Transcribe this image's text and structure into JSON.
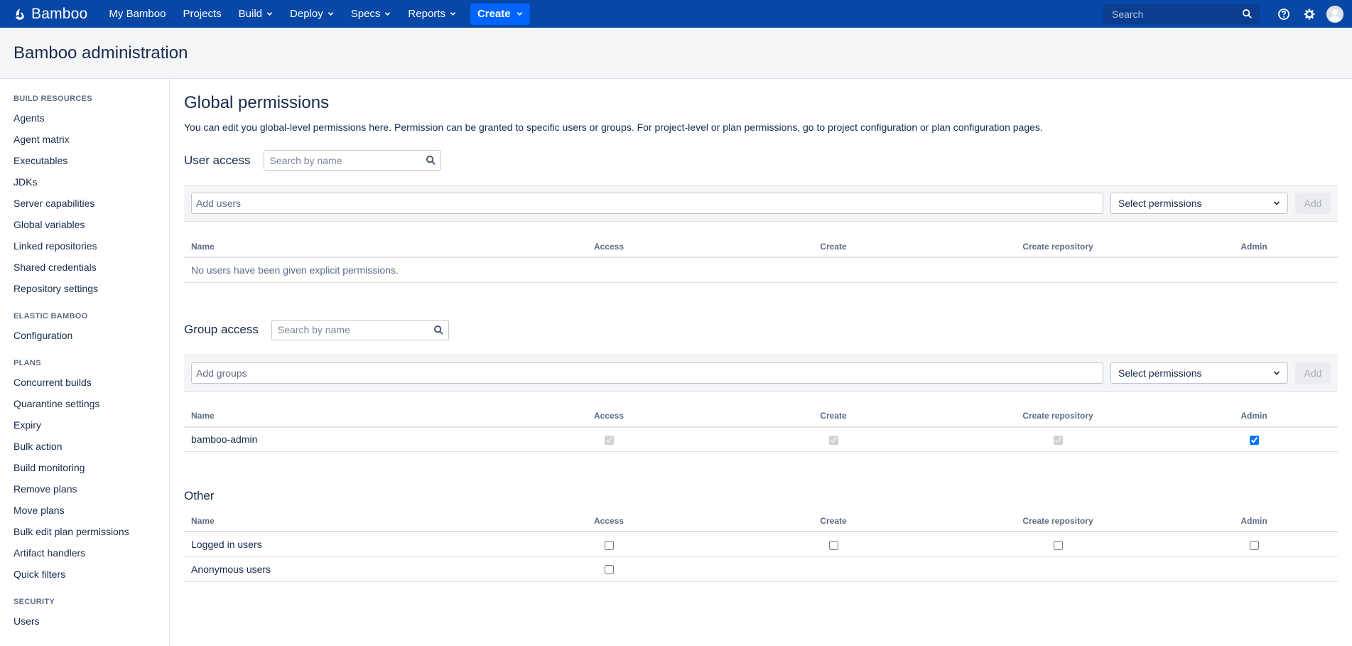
{
  "nav": {
    "logo_text": "Bamboo",
    "links": [
      {
        "label": "My Bamboo",
        "dropdown": false
      },
      {
        "label": "Projects",
        "dropdown": false
      },
      {
        "label": "Build",
        "dropdown": true
      },
      {
        "label": "Deploy",
        "dropdown": true
      },
      {
        "label": "Specs",
        "dropdown": true
      },
      {
        "label": "Reports",
        "dropdown": true
      }
    ],
    "create_label": "Create",
    "search_placeholder": "Search",
    "icons": [
      "help-icon",
      "gear-icon",
      "avatar"
    ],
    "colors": {
      "bar": "#0747a6",
      "create": "#0065ff"
    }
  },
  "header": {
    "title": "Bamboo administration"
  },
  "sidebar": {
    "groups": [
      {
        "heading": "BUILD RESOURCES",
        "items": [
          "Agents",
          "Agent matrix",
          "Executables",
          "JDKs",
          "Server capabilities",
          "Global variables",
          "Linked repositories",
          "Shared credentials",
          "Repository settings"
        ]
      },
      {
        "heading": "ELASTIC BAMBOO",
        "items": [
          "Configuration"
        ]
      },
      {
        "heading": "PLANS",
        "items": [
          "Concurrent builds",
          "Quarantine settings",
          "Expiry",
          "Bulk action",
          "Build monitoring",
          "Remove plans",
          "Move plans",
          "Bulk edit plan permissions",
          "Artifact handlers",
          "Quick filters"
        ]
      },
      {
        "heading": "SECURITY",
        "items": [
          "Users"
        ]
      }
    ]
  },
  "main": {
    "title": "Global permissions",
    "intro": "You can edit you global-level permissions here. Permission can be granted to specific users or groups. For project-level or plan permissions, go to project configuration or plan configuration pages.",
    "columns": [
      "Name",
      "Access",
      "Create",
      "Create repository",
      "Admin"
    ],
    "user_access": {
      "title": "User access",
      "search_placeholder": "Search by name",
      "add_placeholder": "Add users",
      "select_label": "Select permissions",
      "add_label": "Add",
      "empty_text": "No users have been given explicit permissions."
    },
    "group_access": {
      "title": "Group access",
      "search_placeholder": "Search by name",
      "add_placeholder": "Add groups",
      "select_label": "Select permissions",
      "add_label": "Add",
      "rows": [
        {
          "name": "bamboo-admin",
          "access": "checked-disabled",
          "create": "checked-disabled",
          "create_repository": "checked-disabled",
          "admin": "checked"
        }
      ]
    },
    "other": {
      "title": "Other",
      "rows": [
        {
          "name": "Logged in users",
          "access": "unchecked",
          "create": "unchecked",
          "create_repository": "unchecked",
          "admin": "unchecked"
        },
        {
          "name": "Anonymous users",
          "access": "unchecked"
        }
      ]
    }
  }
}
